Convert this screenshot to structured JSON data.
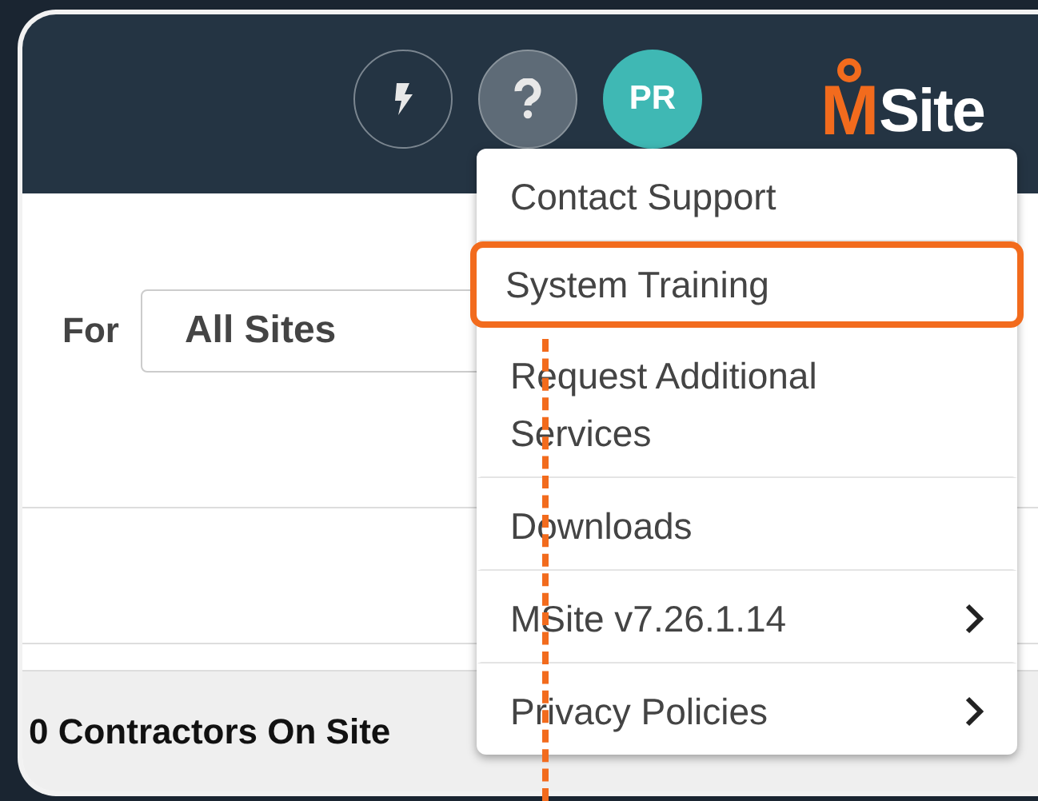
{
  "header": {
    "avatar_initials": "PR",
    "logo": {
      "mark": "M",
      "text": "Site"
    }
  },
  "filter": {
    "label": "For",
    "value": "All Sites"
  },
  "status_bar": {
    "text": "0 Contractors On Site"
  },
  "help_menu": {
    "items": [
      {
        "label": "Contact Support",
        "highlighted": false,
        "has_submenu": false
      },
      {
        "label": "System Training",
        "highlighted": true,
        "has_submenu": false
      },
      {
        "label": "Request Additional Services",
        "highlighted": false,
        "has_submenu": false
      },
      {
        "label": "Downloads",
        "highlighted": false,
        "has_submenu": false
      },
      {
        "label": "MSite v7.26.1.14",
        "highlighted": false,
        "has_submenu": true
      },
      {
        "label": "Privacy Policies",
        "highlighted": false,
        "has_submenu": true
      }
    ]
  }
}
